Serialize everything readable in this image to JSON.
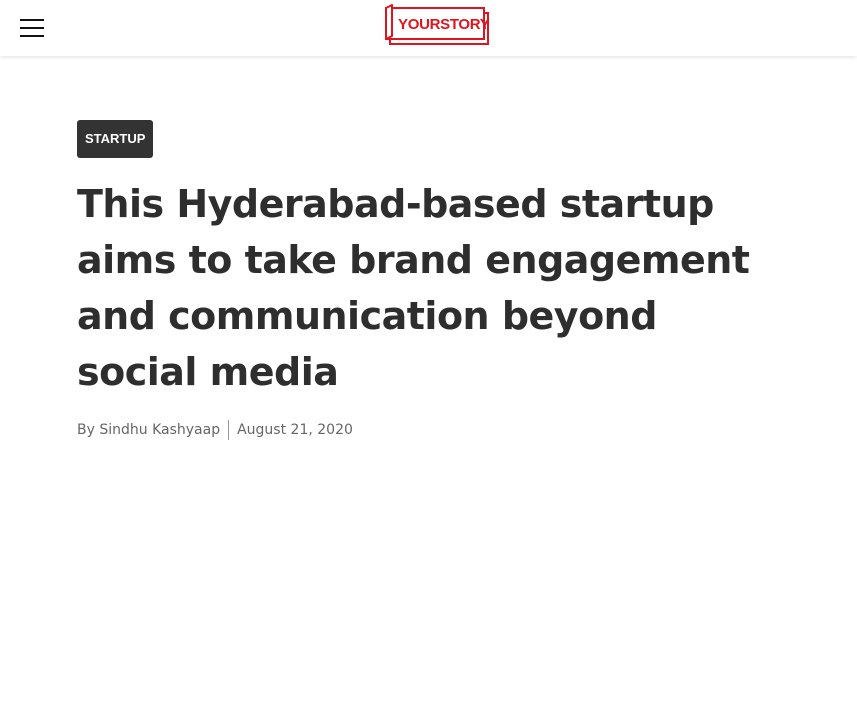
{
  "header": {
    "menu_icon": "hamburger-menu-icon",
    "logo_text": "YOURSTORY",
    "brand_color": "#e0141e"
  },
  "article": {
    "category": "STARTUP",
    "title": "This Hyderabad-based startup aims to take brand engagement and communication beyond social media",
    "author": "By Sindhu Kashyaap",
    "date": "August 21, 2020"
  }
}
